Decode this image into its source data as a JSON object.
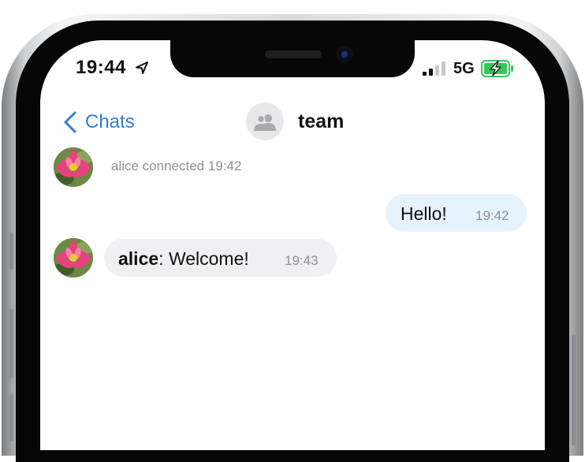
{
  "status_bar": {
    "time": "19:44",
    "network": "5G",
    "location_icon": "location-arrow-icon",
    "signal_icon": "cellular-signal-icon",
    "battery_icon": "battery-charging-icon",
    "battery_color": "#34c759"
  },
  "nav": {
    "back_label": "Chats",
    "title": "team",
    "accent_color": "#2f7ed8"
  },
  "messages": [
    {
      "type": "system",
      "text": "alice connected 19:42",
      "avatar": "water-lily-avatar"
    },
    {
      "type": "outgoing",
      "text": "Hello!",
      "time": "19:42"
    },
    {
      "type": "incoming",
      "sender": "alice",
      "separator": ":",
      "text": "Welcome!",
      "time": "19:43",
      "avatar": "water-lily-avatar"
    }
  ]
}
